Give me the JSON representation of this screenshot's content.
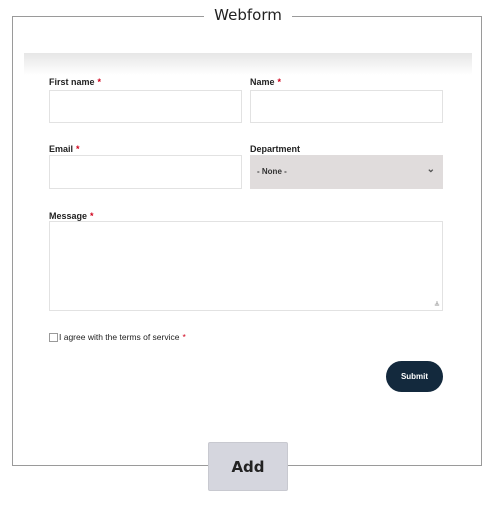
{
  "webform": {
    "title": "Webform",
    "fields": {
      "first_name_label": "First name",
      "name_label": "Name",
      "email_label": "Email",
      "department_label": "Department",
      "department_value": "- None -",
      "message_label": "Message",
      "required_marker": "*"
    },
    "agree_label": "I agree with the terms of service",
    "agree_checked": false,
    "submit_label": "Submit"
  },
  "add_button": {
    "label": "Add"
  },
  "colors": {
    "submit_bg": "#13293d",
    "required": "#d0021b",
    "select_bg": "#e0dcdc",
    "add_bg": "#d5d6de"
  }
}
